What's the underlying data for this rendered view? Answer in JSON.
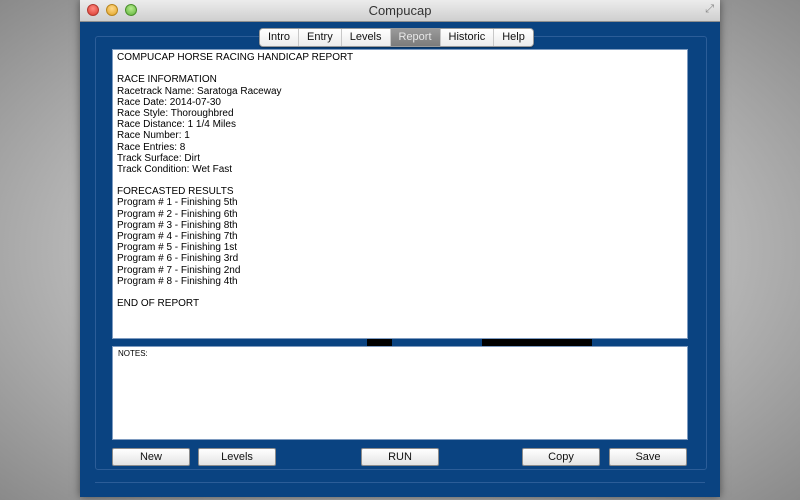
{
  "window": {
    "title": "Compucap"
  },
  "tabs": [
    {
      "label": "Intro",
      "active": false
    },
    {
      "label": "Entry",
      "active": false
    },
    {
      "label": "Levels",
      "active": false
    },
    {
      "label": "Report",
      "active": true
    },
    {
      "label": "Historic",
      "active": false
    },
    {
      "label": "Help",
      "active": false
    }
  ],
  "report": {
    "lines": [
      "COMPUCAP HORSE RACING HANDICAP REPORT",
      "",
      "RACE INFORMATION",
      "Racetrack Name: Saratoga Raceway",
      "Race Date: 2014-07-30",
      "Race Style: Thoroughbred",
      "Race Distance: 1 1/4 Miles",
      "Race Number: 1",
      "Race Entries: 8",
      "Track Surface: Dirt",
      "Track Condition: Wet Fast",
      "",
      "FORECASTED RESULTS",
      "Program # 1 - Finishing 5th",
      "Program # 2 - Finishing 6th",
      "Program # 3 - Finishing 8th",
      "Program # 4 - Finishing 7th",
      "Program # 5 - Finishing 1st",
      "Program # 6 - Finishing 3rd",
      "Program # 7 - Finishing 2nd",
      "Program # 8 - Finishing 4th",
      "",
      "END OF REPORT"
    ]
  },
  "notes": {
    "label": "NOTES:",
    "value": ""
  },
  "buttons": {
    "new": "New",
    "levels": "Levels",
    "run": "RUN",
    "copy": "Copy",
    "save": "Save"
  },
  "colors": {
    "panel_blue": "#0a4381",
    "active_tab": "#8a8a8a"
  }
}
